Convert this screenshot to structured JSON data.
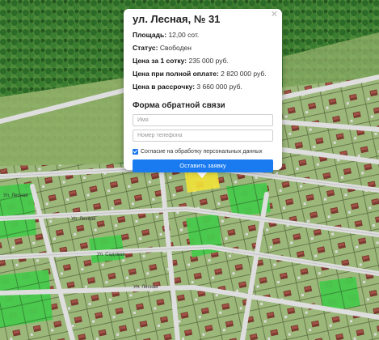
{
  "popup": {
    "title": "ул. Лесная, № 31",
    "close_icon": "close-icon",
    "area_label": "Площадь",
    "area_value": "12,00 сот.",
    "status_label": "Статус",
    "status_value": "Свободен",
    "price_per_sotka_label": "Цена за 1 сотку",
    "price_per_sotka_value": "235 000 руб.",
    "full_payment_label": "Цена при полной оплате",
    "full_payment_value": "2 820 000 руб.",
    "installment_label": "Цена в рассрочку",
    "installment_value": "3 660 000 руб."
  },
  "form": {
    "title": "Форма обратной связи",
    "name_placeholder": "Имя",
    "phone_placeholder": "Номер телефона",
    "consent_label": "Согласие на обработку персональных данных",
    "consent_checked": true,
    "submit_label": "Оставить заявку"
  },
  "map": {
    "street_labels": [
      "Ул. Лесная",
      "Ул. Лесная",
      "Ул. Садовая",
      "Ул. Лесная"
    ]
  },
  "colors": {
    "accent": "#1a7bf0",
    "available_plot": "#3fcf4a",
    "selected_plot": "#f2e23a",
    "grass": "#8aa86a",
    "forest": "#2f6b2a",
    "road": "#d9d9d9"
  }
}
